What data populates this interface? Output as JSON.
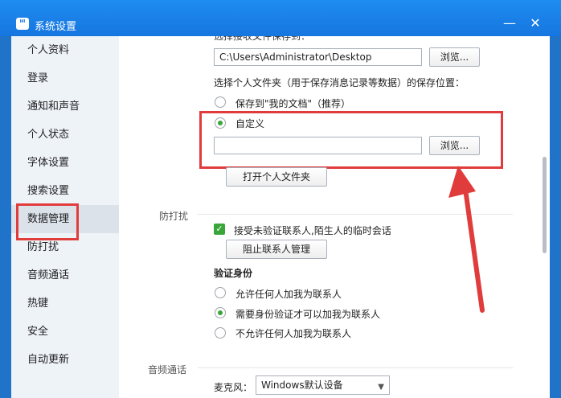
{
  "window": {
    "title": "系统设置"
  },
  "sidebar": {
    "items": [
      {
        "label": "个人资料"
      },
      {
        "label": "登录"
      },
      {
        "label": "通知和声音"
      },
      {
        "label": "个人状态"
      },
      {
        "label": "字体设置"
      },
      {
        "label": "搜索设置"
      },
      {
        "label": "数据管理"
      },
      {
        "label": "防打扰"
      },
      {
        "label": "音频通话"
      },
      {
        "label": "热键"
      },
      {
        "label": "安全"
      },
      {
        "label": "自动更新"
      }
    ],
    "active_index": 6
  },
  "data_mgmt": {
    "top_partial_label": "选择接收文件保存到：",
    "file_path_value": "C:\\Users\\Administrator\\Desktop",
    "browse_label": "浏览...",
    "folder_question": "选择个人文件夹（用于保存消息记录等数据）的保存位置：",
    "opt_my_docs": "保存到\"我的文档\"（推荐）",
    "opt_custom": "自定义",
    "custom_path_value": "",
    "browse2_label": "浏览...",
    "open_folder_label": "打开个人文件夹"
  },
  "anti_disturb": {
    "section_label": "防打扰",
    "accept_temp_label": "接受未验证联系人,陌生人的临时会话",
    "block_mgmt_label": "阻止联系人管理",
    "verify_heading": "验证身份",
    "verify_opt1": "允许任何人加我为联系人",
    "verify_opt2": "需要身份验证才可以加我为联系人",
    "verify_opt3": "不允许任何人加我为联系人"
  },
  "audio": {
    "section_label": "音频通话",
    "mic_label": "麦克风：",
    "mic_device": "Windows默认设备"
  },
  "colors": {
    "titlebar": "#1676e0",
    "accent_green": "#3aa63a",
    "annotation_red": "#e03c3c"
  }
}
